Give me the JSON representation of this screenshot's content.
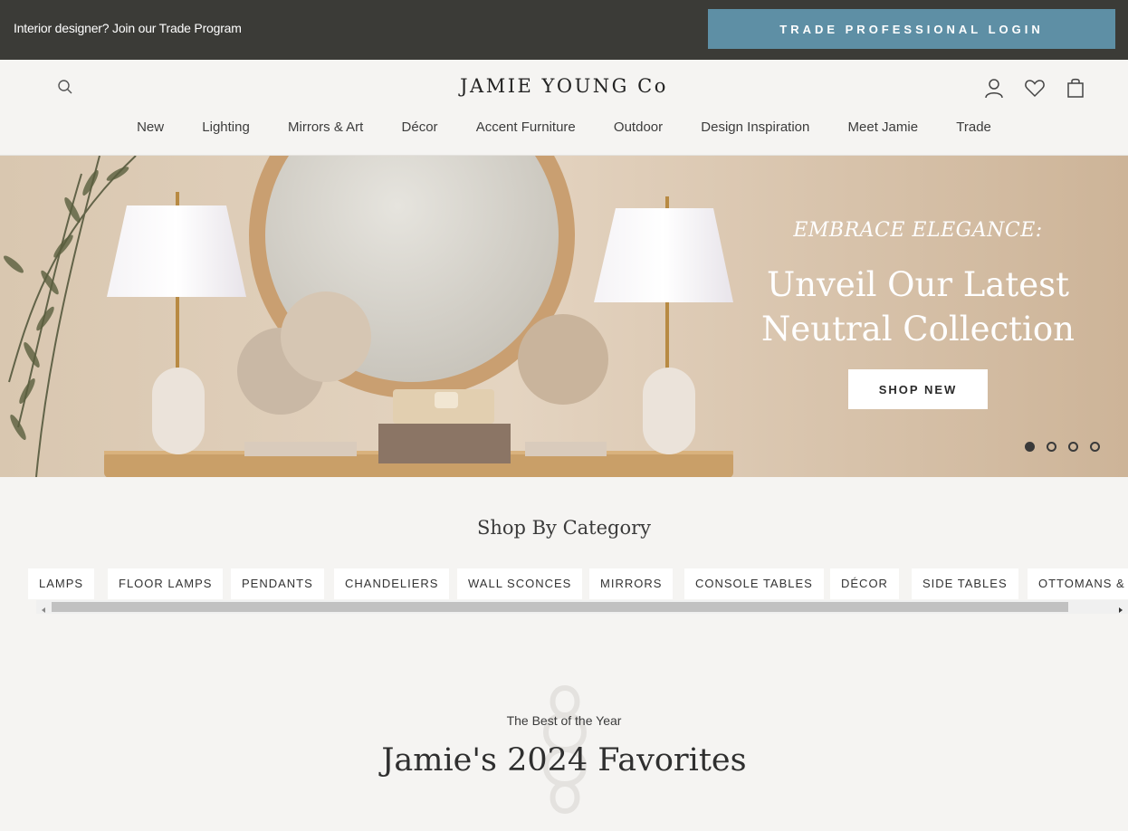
{
  "topbar": {
    "promo_text": "Interior designer? Join our Trade Program",
    "trade_login_label": "TRADE PROFESSIONAL LOGIN",
    "bg_color": "#3b3b37",
    "button_color": "#5e8fa5"
  },
  "header": {
    "logo": "JAMIE YOUNG Co",
    "icons": [
      "search-icon",
      "account-icon",
      "wishlist-heart-icon",
      "shopping-bag-icon"
    ],
    "nav": [
      "New",
      "Lighting",
      "Mirrors & Art",
      "Décor",
      "Accent Furniture",
      "Outdoor",
      "Design Inspiration",
      "Meet Jamie",
      "Trade"
    ]
  },
  "hero": {
    "eyebrow": "EMBRACE ELEGANCE:",
    "title_line1": "Unveil Our Latest",
    "title_line2": "Neutral Collection",
    "cta_label": "SHOP NEW",
    "slide_count": 4,
    "active_slide": 1
  },
  "categories": {
    "title": "Shop By Category",
    "items": [
      "LAMPS",
      "FLOOR LAMPS",
      "PENDANTS",
      "CHANDELIERS",
      "WALL SCONCES",
      "MIRRORS",
      "CONSOLE TABLES",
      "DÉCOR",
      "SIDE TABLES",
      "OTTOMANS & S"
    ]
  },
  "favorites": {
    "eyebrow": "The Best of the Year",
    "title": "Jamie's 2024 Favorites"
  }
}
